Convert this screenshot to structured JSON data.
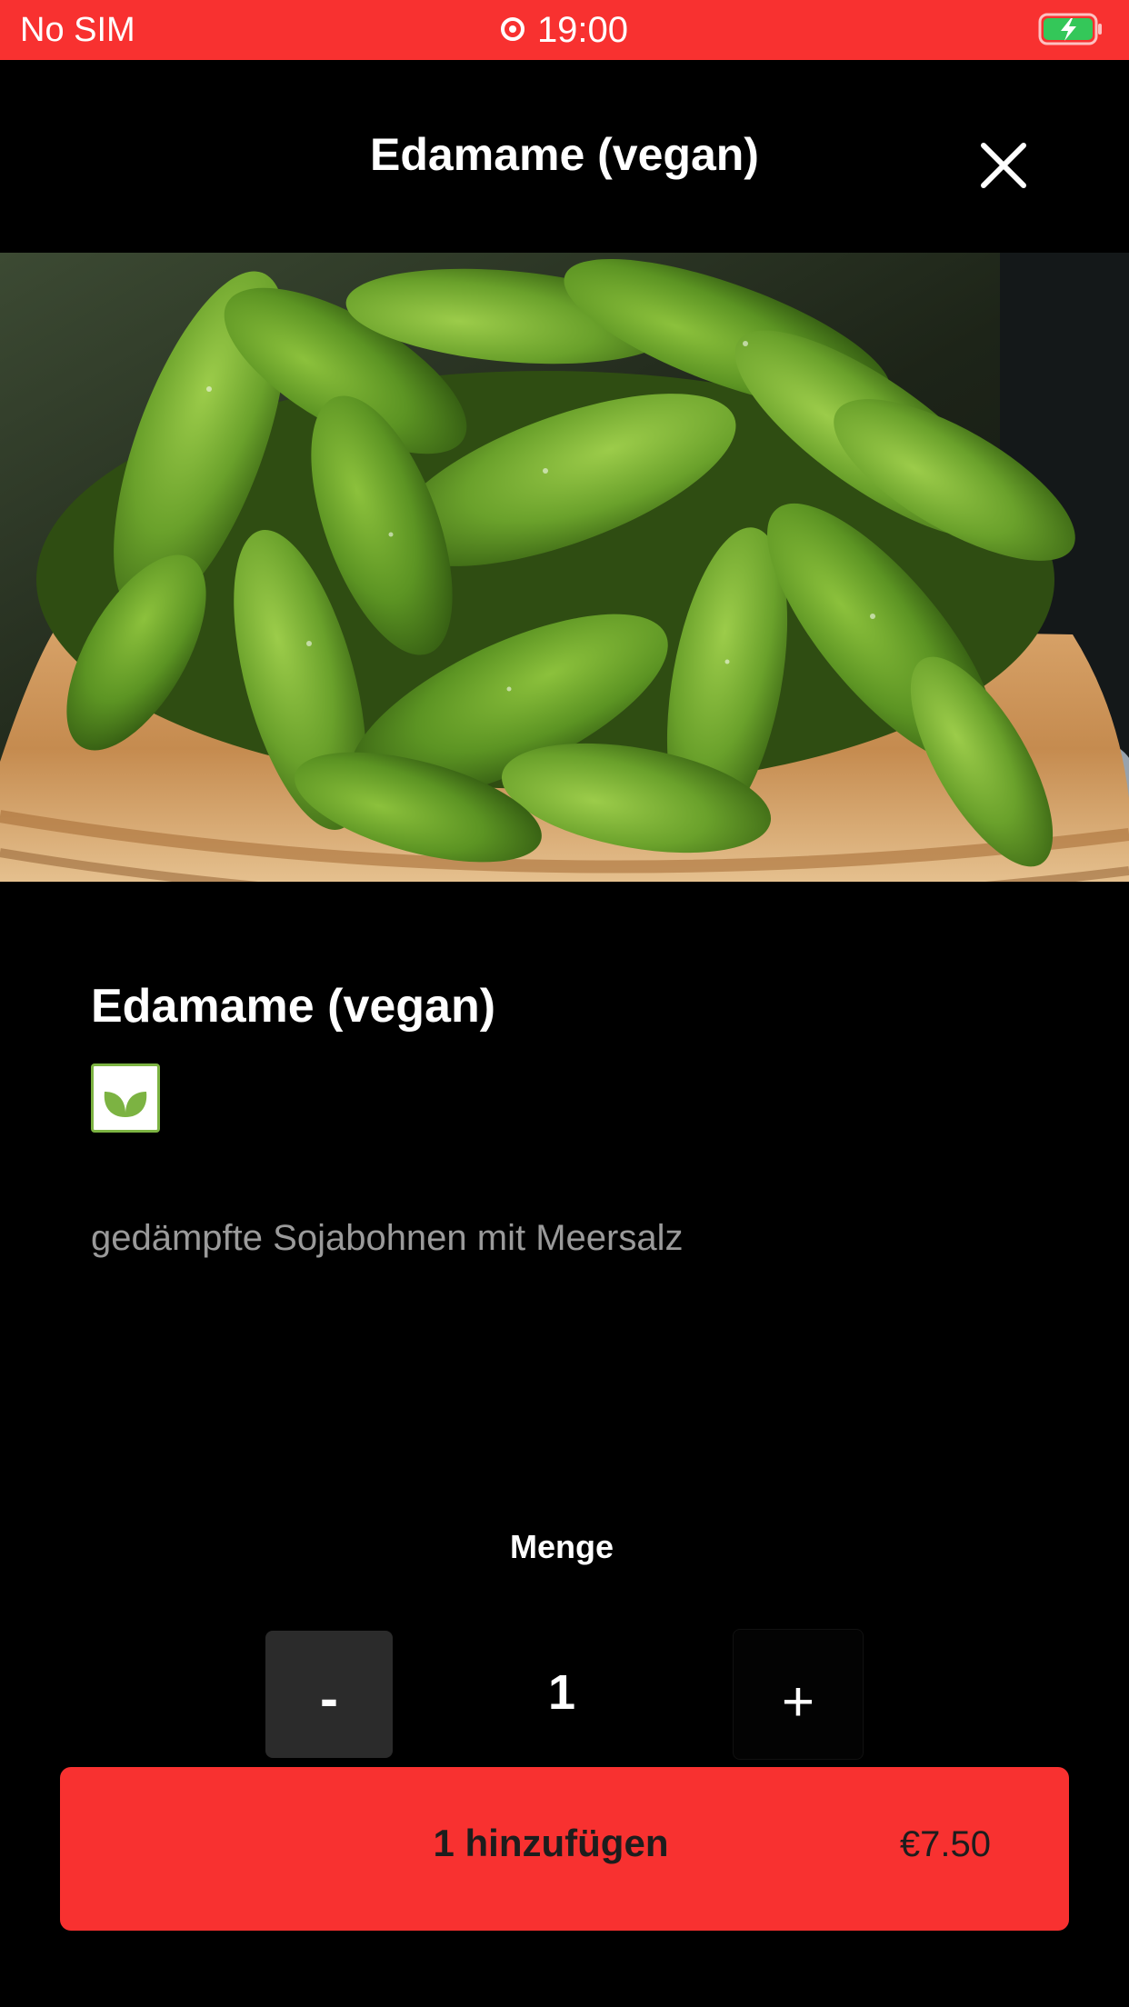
{
  "status_bar": {
    "carrier": "No SIM",
    "time": "19:00",
    "battery_state": "charging",
    "background_color": "#f83130"
  },
  "header": {
    "title": "Edamame (vegan)",
    "close_icon": "close-icon"
  },
  "hero_image": {
    "subject": "edamame-in-bamboo-steamer"
  },
  "product": {
    "name": "Edamame (vegan)",
    "badge_icon": "vegan-leaf-icon",
    "description": "gedämpfte Sojabohnen mit Meersalz"
  },
  "quantity": {
    "label": "Menge",
    "decrement_label": "-",
    "value": "1",
    "increment_label": "+"
  },
  "add_button": {
    "label": "1 hinzufügen",
    "price": "€7.50",
    "color": "#f83130"
  },
  "colors": {
    "accent": "#f83130",
    "background": "#000000",
    "vegan_green": "#7cb342",
    "description_gray": "#9a9a9a"
  }
}
